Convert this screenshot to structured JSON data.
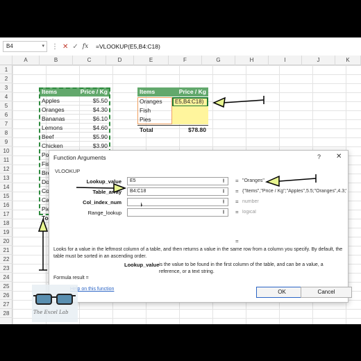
{
  "formula_bar": {
    "name_box": "B4",
    "formula": "=VLOOKUP(E5,B4:C18)"
  },
  "icons": {
    "more": "more-icon",
    "cancel": "x-icon",
    "enter": "check-icon",
    "function": "fx-icon",
    "collapse": "arrow-up-icon",
    "close": "close-icon",
    "help": "help-icon"
  },
  "columns": [
    "A",
    "B",
    "C",
    "D",
    "E",
    "F",
    "G",
    "H",
    "I",
    "J",
    "K"
  ],
  "rows": [
    "1",
    "2",
    "3",
    "4",
    "5",
    "6",
    "7",
    "8",
    "9",
    "10",
    "11",
    "12",
    "13",
    "14",
    "15",
    "16",
    "17",
    "18",
    "19",
    "20",
    "21",
    "22",
    "23",
    "24",
    "25",
    "26",
    "27",
    "28"
  ],
  "left_table": {
    "header": [
      "Items",
      "Price / Kg"
    ],
    "rows": [
      [
        "Apples",
        "$5.50"
      ],
      [
        "Oranges",
        "$4.30"
      ],
      [
        "Bananas",
        "$6.10"
      ],
      [
        "Lemons",
        "$4.60"
      ],
      [
        "Beef",
        "$5.90"
      ],
      [
        "Chicken",
        "$3.90"
      ],
      [
        "Po",
        ""
      ],
      [
        "Fis",
        ""
      ],
      [
        "Bre",
        ""
      ],
      [
        "Do",
        ""
      ],
      [
        "Co",
        ""
      ],
      [
        "Ca",
        ""
      ],
      [
        "Pie",
        ""
      ],
      [
        "To",
        ""
      ]
    ]
  },
  "right_table": {
    "header": [
      "Items",
      "Price / Kg"
    ],
    "rows": [
      [
        "Oranges",
        "E5,B4:C18)"
      ],
      [
        "Fish",
        ""
      ],
      [
        "Pies",
        ""
      ]
    ],
    "total_label": "Total",
    "total_value": "$78.80"
  },
  "dialog": {
    "title": "Function Arguments",
    "help_glyph": "?",
    "close_glyph": "✕",
    "function_name": "VLOOKUP",
    "args": [
      {
        "label": "Lookup_value",
        "value": "E5",
        "result": "\"Oranges\""
      },
      {
        "label": "Table_array",
        "value": "B4:C18",
        "result": "{\"Items\",\"Price / Kg\";\"Apples\",5.5;\"Oranges\",4.3;\"..."
      },
      {
        "label": "Col_index_num",
        "value": "",
        "result": "number"
      },
      {
        "label": "Range_lookup",
        "value": "",
        "result": "logical"
      }
    ],
    "equals": "=",
    "description": "Looks for a value in the leftmost column of a table, and then returns a value in the same row from a column you specify. By default, the table must be sorted in an ascending order.",
    "arg_name": "Lookup_value",
    "arg_description": "is the value to be found in the first column of the table, and can be a value, a reference, or a text string.",
    "formula_result": "Formula result =",
    "help_link": "Help on this function",
    "ok": "OK",
    "cancel": "Cancel"
  },
  "logo": {
    "text": "The Excel Lab"
  },
  "colors": {
    "green_header": "#62a86c",
    "yellow": "#fff59d",
    "selection": "#2e8b3e",
    "arrow": "#000000"
  }
}
